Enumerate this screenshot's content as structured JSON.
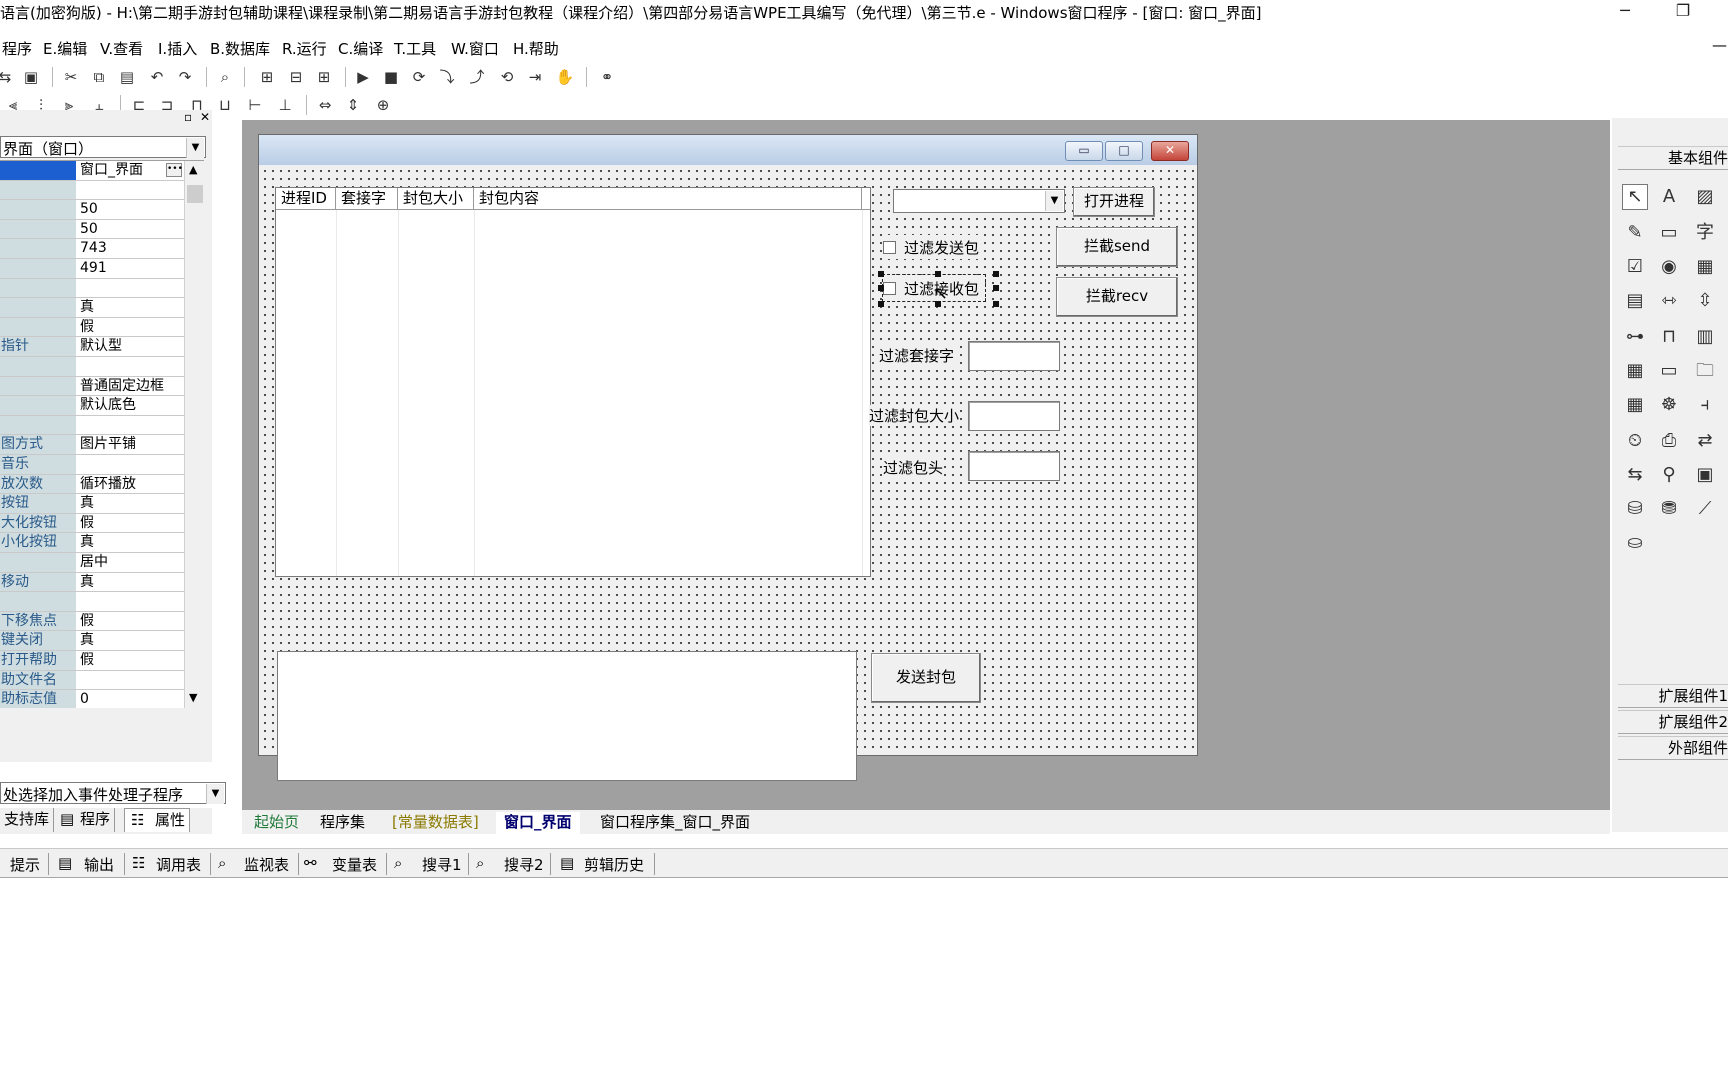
{
  "window": {
    "title": "语言(加密狗版) - H:\\第二期手游封包辅助课程\\课程录制\\第二期易语言手游封包教程（课程介绍）\\第四部分易语言WPE工具编写（免代理）\\第三节.e - Windows窗口程序 - [窗口: 窗口_界面]",
    "minimize_glyph": "─",
    "maximize_glyph": "❐"
  },
  "menu": [
    {
      "label": "程序"
    },
    {
      "label": "E.编辑"
    },
    {
      "label": "V.查看"
    },
    {
      "label": "I.插入"
    },
    {
      "label": "B.数据库"
    },
    {
      "label": "R.运行"
    },
    {
      "label": "C.编译"
    },
    {
      "label": "T.工具"
    },
    {
      "label": "W.窗口"
    },
    {
      "label": "H.帮助"
    }
  ],
  "menu_right_glyph": "—",
  "left_panel": {
    "object_combo": "界面（窗口）",
    "properties": [
      {
        "name": "",
        "value": "窗口_界面",
        "selected": true
      },
      {
        "name": "",
        "value": ""
      },
      {
        "name": "",
        "value": "50"
      },
      {
        "name": "",
        "value": "50"
      },
      {
        "name": "",
        "value": "743"
      },
      {
        "name": "",
        "value": "491"
      },
      {
        "name": "",
        "value": ""
      },
      {
        "name": "",
        "value": "真"
      },
      {
        "name": "",
        "value": "假"
      },
      {
        "name": "指针",
        "value": "默认型"
      },
      {
        "name": "",
        "value": ""
      },
      {
        "name": "",
        "value": "普通固定边框"
      },
      {
        "name": "",
        "value": "默认底色"
      },
      {
        "name": "",
        "value": ""
      },
      {
        "name": "图方式",
        "value": "图片平铺"
      },
      {
        "name": "音乐",
        "value": ""
      },
      {
        "name": "放次数",
        "value": "循环播放"
      },
      {
        "name": "按钮",
        "value": "真"
      },
      {
        "name": "大化按钮",
        "value": "假"
      },
      {
        "name": "小化按钮",
        "value": "真"
      },
      {
        "name": "",
        "value": "居中"
      },
      {
        "name": "移动",
        "value": "真"
      },
      {
        "name": "",
        "value": ""
      },
      {
        "name": "下移焦点",
        "value": "假"
      },
      {
        "name": "键关闭",
        "value": "真"
      },
      {
        "name": "打开帮助",
        "value": "假"
      },
      {
        "name": "助文件名",
        "value": ""
      },
      {
        "name": "助标志值",
        "value": "0"
      }
    ],
    "event_combo": "处选择加入事件处理子程序",
    "tabs": [
      {
        "label": "支持库"
      },
      {
        "label": "程序"
      },
      {
        "label": "属性"
      }
    ]
  },
  "form": {
    "list_columns": [
      "进程ID",
      "套接字",
      "封包大小",
      "封包内容"
    ],
    "process_combo_value": "",
    "open_process_button": "打开进程",
    "filter_send_label": "过滤发送包",
    "filter_recv_label": "过滤接收包",
    "intercept_send_button": "拦截send",
    "intercept_recv_button": "拦截recv",
    "filter_socket_label": "过滤套接字",
    "filter_size_label": "过滤封包大小",
    "filter_header_label": "过滤包头",
    "send_packet_button": "发送封包"
  },
  "doc_tabs": [
    {
      "label": "起始页",
      "color": "#1f7a3a"
    },
    {
      "label": "程序集",
      "color": "#000000"
    },
    {
      "label": "[常量数据表]",
      "color": "#8a7a00"
    },
    {
      "label": "窗口_界面",
      "color": "#00006e",
      "active": true
    },
    {
      "label": "窗口程序集_窗口_界面",
      "color": "#000000"
    }
  ],
  "right_panel": {
    "basic_label": "基本组件",
    "ext1_label": "扩展组件1",
    "ext2_label": "扩展组件2",
    "external_label": "外部组件"
  },
  "statusbar": [
    {
      "label": "提示"
    },
    {
      "label": "输出"
    },
    {
      "label": "调用表"
    },
    {
      "label": "监视表"
    },
    {
      "label": "变量表"
    },
    {
      "label": "搜寻1"
    },
    {
      "label": "搜寻2"
    },
    {
      "label": "剪辑历史"
    }
  ],
  "colors": {
    "prop_name_bg": "#cfdde0",
    "designer_bg": "#a0a0a0",
    "selection_bg": "#1c5fd1"
  }
}
